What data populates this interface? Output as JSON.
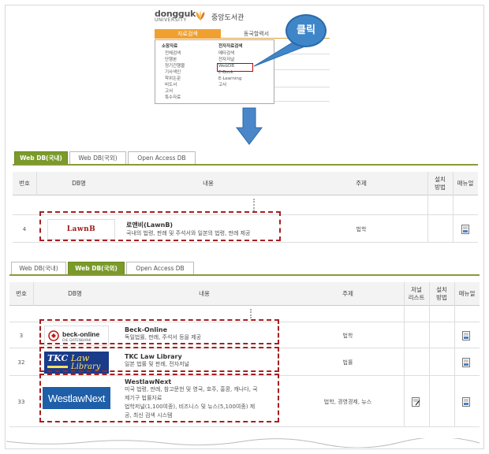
{
  "library": {
    "university_line1": "dongguk",
    "university_line2": "UNIVERSITY",
    "library_name": "중앙도서관",
    "menu_active": "자료검색",
    "menu_other": "동국할력서",
    "dropdown": {
      "col1_header": "소장자료",
      "col1_items": [
        "전체검색",
        "단행본",
        "정기간행물",
        "기사색인",
        "학위논문",
        "비도서",
        "고서",
        "특수자료"
      ],
      "col2_header": "전자자료검색",
      "col2_items": [
        "메타검색",
        "전자저널",
        "WebDB",
        "E-Book",
        "E-Learning",
        "고서"
      ]
    }
  },
  "callout": {
    "text": "클릭"
  },
  "panel1": {
    "tabs": [
      {
        "label": "Web DB(국내)",
        "active": true
      },
      {
        "label": "Web DB(국외)",
        "active": false
      },
      {
        "label": "Open Access DB",
        "active": false
      }
    ],
    "headers": {
      "no": "번호",
      "dbname": "DB명",
      "content": "내용",
      "subject": "주제",
      "install": "설치\n방법",
      "manual": "매뉴얼"
    },
    "rows": [
      {
        "no": "4",
        "logo_text": "LawnB",
        "title": "로앤비(LawnB)",
        "desc": "국내의 법령, 판례 및 주석서와 일본의 법령, 판례 제공",
        "subject": "법학"
      }
    ]
  },
  "panel2": {
    "tabs": [
      {
        "label": "Web DB(국내)",
        "active": false
      },
      {
        "label": "Web DB(국외)",
        "active": true
      },
      {
        "label": "Open Access DB",
        "active": false
      }
    ],
    "headers": {
      "no": "번호",
      "dbname": "DB명",
      "content": "내용",
      "subject": "주제",
      "journal": "저널\n리스트",
      "install": "설치\n방법",
      "manual": "매뉴얼"
    },
    "rows": [
      {
        "no": "3",
        "logo_text": "beck-online",
        "logo_sub": "DIE DATENBANK",
        "title": "Beck-Online",
        "desc": "독일법률, 판례, 주석서 등을 제공",
        "subject": "법학"
      },
      {
        "no": "32",
        "logo_text": "TKC",
        "logo_sub1": "Law",
        "logo_sub2": "Library",
        "title": "TKC Law Library",
        "desc": "일본 법률 및 판례, 전자저널",
        "subject": "법률"
      },
      {
        "no": "33",
        "logo_text": "WestlawNext",
        "title": "WestlawNext",
        "desc_lines": [
          "미국 법령, 판례, 참고문헌 및 영국, 호주, 홍콩, 캐나다, 국",
          "제기구 법률자료",
          "법학저널(1,100여종), 비즈니스 및 뉴스(5,100여종) 제",
          "공, 최신 검색 시스템"
        ],
        "subject": "법학, 경영경제, 뉴스"
      }
    ]
  },
  "colors": {
    "accent_green": "#7a9a2a",
    "highlight_red": "#a52020",
    "callout_blue": "#3f86c9",
    "menu_orange": "#f0a030"
  }
}
